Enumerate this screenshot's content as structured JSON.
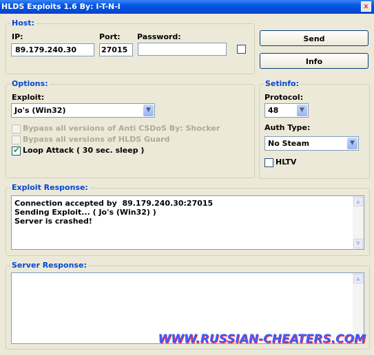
{
  "window": {
    "title": "HLDS Exploits 1.6 By: I-T-N-I",
    "close_glyph": "x"
  },
  "host": {
    "group_label": "Host:",
    "ip_label": "IP:",
    "ip_value": "89.179.240.30",
    "port_label": "Port:",
    "port_value": "27015",
    "password_label": "Password:",
    "password_value": ""
  },
  "buttons": {
    "send": "Send",
    "info": "Info"
  },
  "options": {
    "group_label": "Options:",
    "exploit_label": "Exploit:",
    "exploit_selected": "Jo's (Win32)",
    "checkboxes": [
      {
        "label": "Bypass all versions of Anti CSDoS By: Shocker",
        "checked": false,
        "enabled": false
      },
      {
        "label": "Bypass all versions of HLDS Guard",
        "checked": false,
        "enabled": false
      },
      {
        "label": "Loop Attack ( 30 sec. sleep )",
        "checked": true,
        "enabled": true
      }
    ]
  },
  "setinfo": {
    "group_label": "Setinfo:",
    "protocol_label": "Protocol:",
    "protocol_selected": "48",
    "auth_label": "Auth Type:",
    "auth_selected": "No Steam",
    "hltv_label": "HLTV"
  },
  "exploit_response": {
    "group_label": "Exploit Response:",
    "text": "Connection accepted by  89.179.240.30:27015\nSending Exploit... ( Jo's (Win32) )\nServer is crashed!"
  },
  "server_response": {
    "group_label": "Server Response:",
    "text": ""
  },
  "watermark": "WWW.RUSSIAN-CHEATERS.COM",
  "colors": {
    "group_label": "#0046d5",
    "titlebar": "#0055e5",
    "face": "#ece9d8"
  }
}
